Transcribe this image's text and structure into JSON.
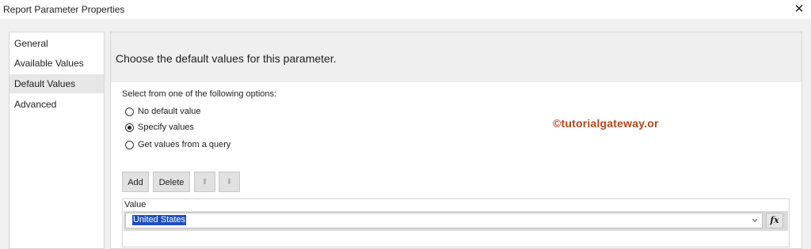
{
  "window": {
    "title": "Report Parameter Properties",
    "close_icon": "close-icon"
  },
  "nav": {
    "items": [
      {
        "label": "General"
      },
      {
        "label": "Available Values"
      },
      {
        "label": "Default Values",
        "selected": true
      },
      {
        "label": "Advanced"
      }
    ]
  },
  "content": {
    "header": "Choose the default values for this parameter.",
    "options_label": "Select from one of the following options:",
    "options": [
      {
        "label": "No default value",
        "checked": false
      },
      {
        "label": "Specify values",
        "checked": true
      },
      {
        "label": "Get values from a query",
        "checked": false
      }
    ],
    "watermark": "©tutorialgateway.or",
    "toolbar": {
      "add_label": "Add",
      "delete_label": "Delete",
      "move_up_icon": "arrow-up-icon",
      "move_down_icon": "arrow-down-icon"
    },
    "grid": {
      "header": "Value",
      "value": "United States",
      "fx_label": "fx"
    }
  },
  "colors": {
    "selection": "#1f4fbf",
    "watermark": "#b5451b"
  }
}
